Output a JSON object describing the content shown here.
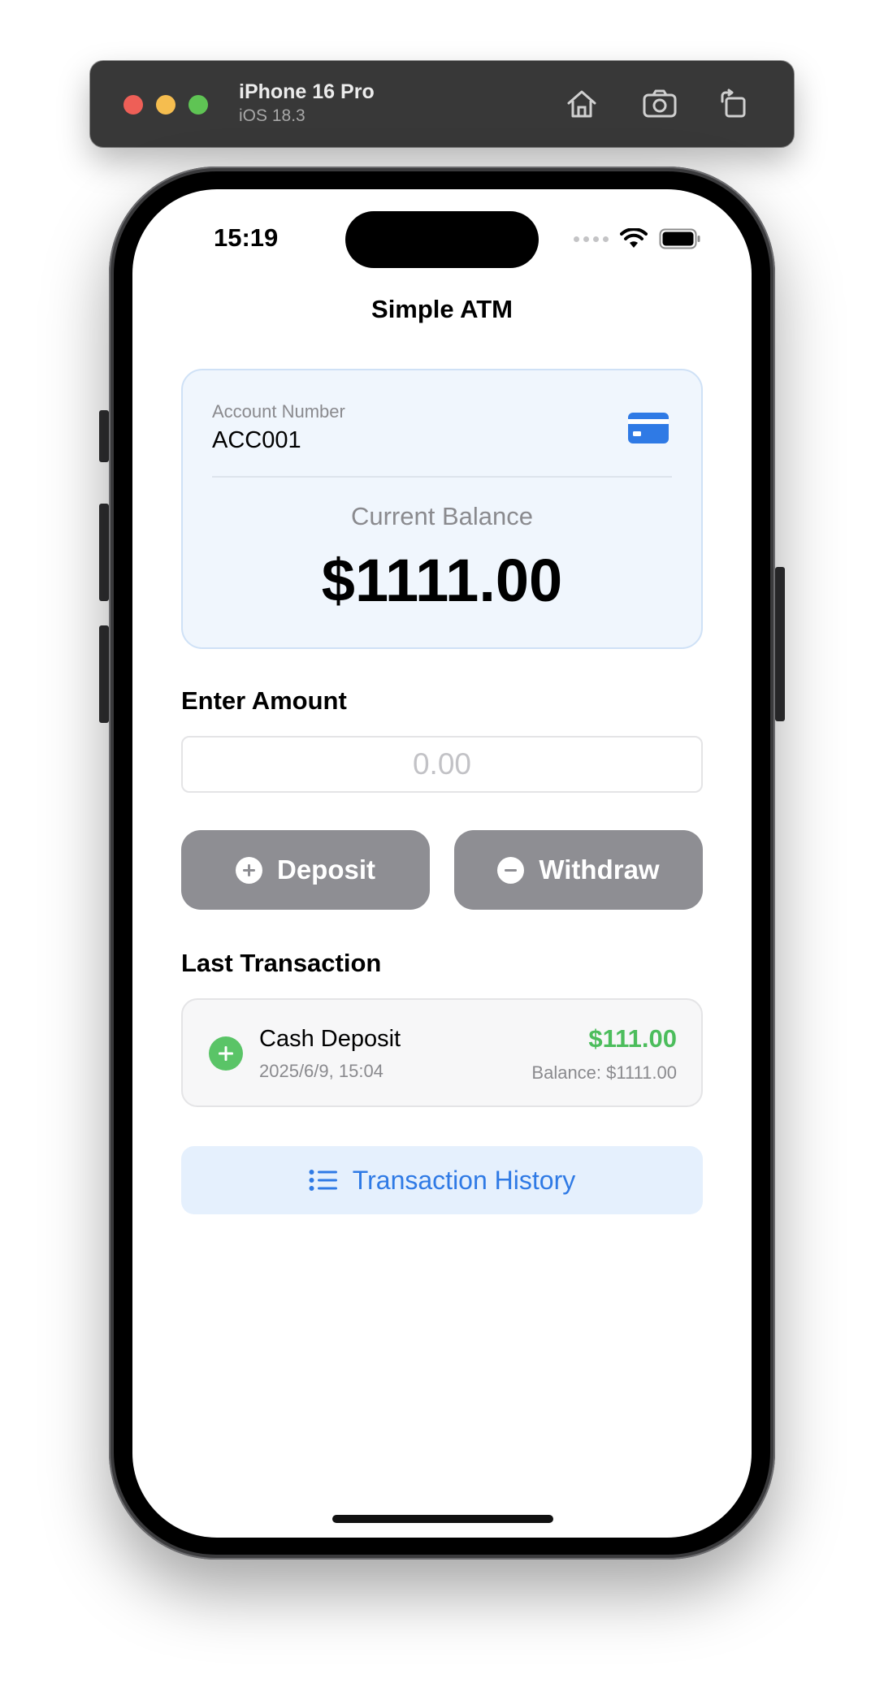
{
  "simulator": {
    "device_name": "iPhone 16 Pro",
    "os_version": "iOS 18.3",
    "buttons": [
      "home-icon",
      "screenshot-icon",
      "rotate-icon"
    ]
  },
  "status_bar": {
    "time": "15:19"
  },
  "nav": {
    "title": "Simple ATM"
  },
  "account": {
    "number_label": "Account Number",
    "number": "ACC001",
    "icon": "credit-card-icon",
    "balance_label": "Current Balance",
    "balance": "$1111.00"
  },
  "amount": {
    "label": "Enter Amount",
    "placeholder": "0.00",
    "value": ""
  },
  "actions": {
    "deposit_label": "Deposit",
    "withdraw_label": "Withdraw"
  },
  "last_transaction": {
    "section_label": "Last Transaction",
    "title": "Cash Deposit",
    "date": "2025/6/9, 15:04",
    "amount": "$111.00",
    "balance": "Balance: $1111.00"
  },
  "history": {
    "label": "Transaction History"
  },
  "colors": {
    "accent": "#2f7ae5",
    "success": "#4cbd5c",
    "button_disabled": "#8e8e93",
    "card_background": "#f0f6fd"
  }
}
